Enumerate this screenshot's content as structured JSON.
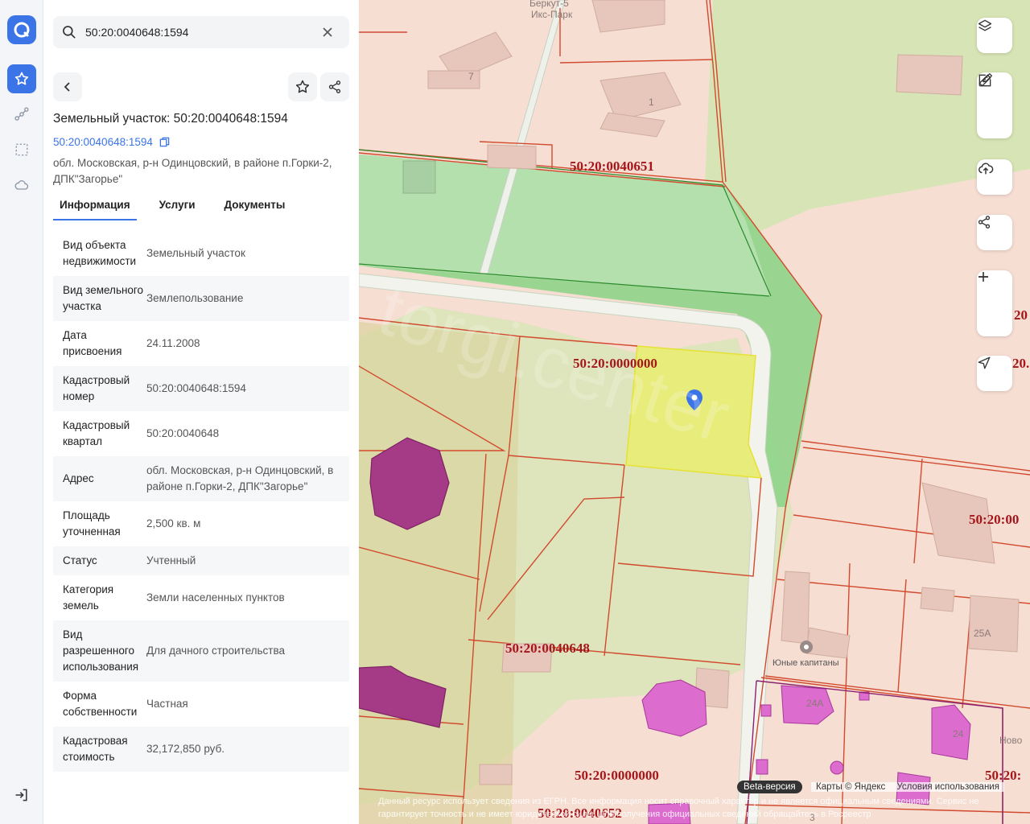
{
  "search": {
    "value": "50:20:0040648:1594"
  },
  "parcel": {
    "title": "Земельный участок: 50:20:0040648:1594",
    "cad_link": "50:20:0040648:1594",
    "address": "обл. Московская, р-н Одинцовский, в районе п.Горки-2, ДПК\"Загорье\""
  },
  "tabs": [
    {
      "label": "Информация",
      "active": true
    },
    {
      "label": "Услуги",
      "active": false
    },
    {
      "label": "Документы",
      "active": false
    }
  ],
  "info_rows": [
    {
      "key": "Вид объекта недвижимости",
      "value": "Земельный участок"
    },
    {
      "key": "Вид земельного участка",
      "value": "Землепользование"
    },
    {
      "key": "Дата присвоения",
      "value": "24.11.2008"
    },
    {
      "key": "Кадастровый номер",
      "value": "50:20:0040648:1594"
    },
    {
      "key": "Кадастровый квартал",
      "value": "50:20:0040648"
    },
    {
      "key": "Адрес",
      "value": "обл. Московская, р-н Одинцовский, в районе п.Горки-2, ДПК\"Загорье\""
    },
    {
      "key": "Площадь уточненная",
      "value": "2,500 кв. м"
    },
    {
      "key": "Статус",
      "value": "Учтенный"
    },
    {
      "key": "Категория земель",
      "value": "Земли населенных пунктов"
    },
    {
      "key": "Вид разрешенного использования",
      "value": "Для дачного строительства"
    },
    {
      "key": "Форма собственности",
      "value": "Частная"
    },
    {
      "key": "Кадастровая стоимость",
      "value": "32,172,850 руб."
    }
  ],
  "map": {
    "labels": {
      "q_0040651": "50:20:0040651",
      "q_0000000_top": "50:20:0000000",
      "q_0040648": "50:20:0040648",
      "q_0000000_bottom": "50:20:0000000",
      "q_0040652": "50:20:0040652",
      "q_right_1": "50:20:00",
      "q_right_2": "50:20:",
      "q_right_edge_1": "20",
      "q_right_edge_2": "20.",
      "place_top": "Беркут-5",
      "place_top2": "Икс-Парк",
      "house_7": "7",
      "house_1": "1",
      "house_25a": "25А",
      "house_24a": "24А",
      "house_24": "24",
      "house_3": "3",
      "poi_camp": "Юные капитаны",
      "street_partial": "Ново",
      "watermark": "torgi.center"
    },
    "beta": "Beta-версия",
    "copyright": "Карты © Яндекс",
    "terms": "Условия использования",
    "disclaimer": "Данный ресурс использует сведения из ЕГРН. Все информация носит справочный характер и не является официальным сведениями. Сервис не гарантирует точность и не имеет юридической силы. Для получения официальных сведений обращайтесь в Росреестр"
  },
  "colors": {
    "accent": "#3a74e6",
    "selected_parcel": "#e8ec7a",
    "green_zone": "#8fd48a",
    "boundary": "#d24a2e"
  }
}
